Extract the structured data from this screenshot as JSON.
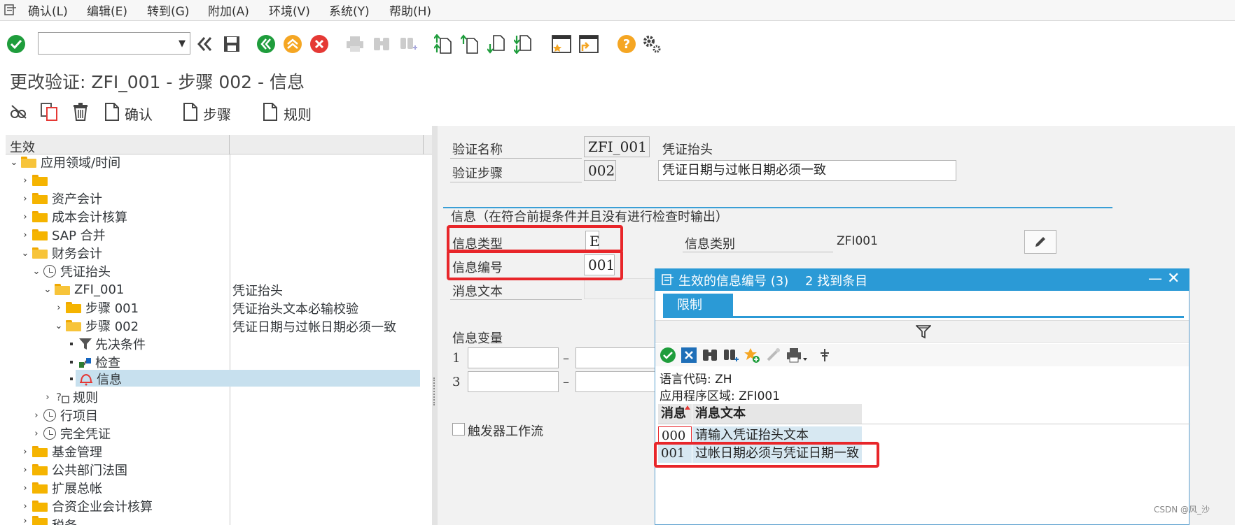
{
  "menu": {
    "items": [
      "确认(L)",
      "编辑(E)",
      "转到(G)",
      "附加(A)",
      "环境(V)",
      "系统(Y)",
      "帮助(H)"
    ]
  },
  "toolbar": {
    "command_field": "",
    "icons": [
      "check-icon",
      "back-double-icon",
      "save-icon",
      "back-icon",
      "exit-icon",
      "cancel-icon",
      "print-icon",
      "find-icon",
      "find-next-icon",
      "first-page-icon",
      "prev-page-icon",
      "next-page-icon",
      "last-page-icon",
      "new-session-icon",
      "shortcut-icon",
      "help-icon",
      "settings-icon"
    ]
  },
  "page": {
    "title": "更改验证: ZFI_001 - 步骤 002 - 信息"
  },
  "app_toolbar": {
    "confirm_label": "确认",
    "step_label": "步骤",
    "rule_label": "规则"
  },
  "tree": {
    "header": "生效",
    "rows": [
      {
        "label": "应用领域/时间",
        "desc": ""
      },
      {
        "label": "",
        "desc": ""
      },
      {
        "label": "资产会计",
        "desc": ""
      },
      {
        "label": "成本会计核算",
        "desc": ""
      },
      {
        "label": "SAP 合并",
        "desc": ""
      },
      {
        "label": "财务会计",
        "desc": ""
      },
      {
        "label": "凭证抬头",
        "desc": ""
      },
      {
        "label": "ZFI_001",
        "desc": "凭证抬头"
      },
      {
        "label": "步骤 001",
        "desc": "凭证抬头文本必输校验"
      },
      {
        "label": "步骤 002",
        "desc": "凭证日期与过帐日期必须一致"
      },
      {
        "label": "先决条件",
        "desc": ""
      },
      {
        "label": "检查",
        "desc": ""
      },
      {
        "label": "信息",
        "desc": ""
      },
      {
        "label": "规则",
        "desc": ""
      },
      {
        "label": "行项目",
        "desc": ""
      },
      {
        "label": "完全凭证",
        "desc": ""
      },
      {
        "label": "基金管理",
        "desc": ""
      },
      {
        "label": "公共部门法国",
        "desc": ""
      },
      {
        "label": "扩展总帐",
        "desc": ""
      },
      {
        "label": "合资企业会计核算",
        "desc": ""
      },
      {
        "label": "税务",
        "desc": ""
      }
    ]
  },
  "detail": {
    "validation_name_label": "验证名称",
    "validation_name_value": "ZFI_001",
    "validation_name_desc": "凭证抬头",
    "validation_step_label": "验证步骤",
    "validation_step_value": "002",
    "validation_step_desc": "凭证日期与过帐日期必须一致",
    "group_title": "信息（在符合前提条件并且没有进行检查时输出）",
    "msg_type_label": "信息类型",
    "msg_type_value": "E",
    "msg_class_label": "信息类别",
    "msg_class_value": "ZFI001",
    "msg_no_label": "信息编号",
    "msg_no_value": "001",
    "msg_text_label": "消息文本",
    "msg_vars_label": "信息变量",
    "var_row1": "1",
    "var_row3": "3",
    "dash": "–",
    "trigger_label": "触发器工作流"
  },
  "popup": {
    "title": "生效的信息编号 (3)",
    "found": "2 找到条目",
    "tab": "限制",
    "lang_label": "语言代码",
    "lang_value": "ZH",
    "area_label": "应用程序区域",
    "area_value": "ZFI001",
    "col_msg": "消息",
    "col_text": "消息文本",
    "rows": [
      {
        "no": "000",
        "text": "请输入凭证抬头文本"
      },
      {
        "no": "001",
        "text": "过帐日期必须与凭证日期一致"
      }
    ]
  },
  "colors": {
    "accent": "#2b9ad6",
    "highlight": "#e8262a",
    "selection": "#c7e0ee",
    "ok_green": "#1f9d3c",
    "cancel_red": "#e53935",
    "orange": "#f5a623"
  },
  "watermark": "CSDN @风_沙"
}
